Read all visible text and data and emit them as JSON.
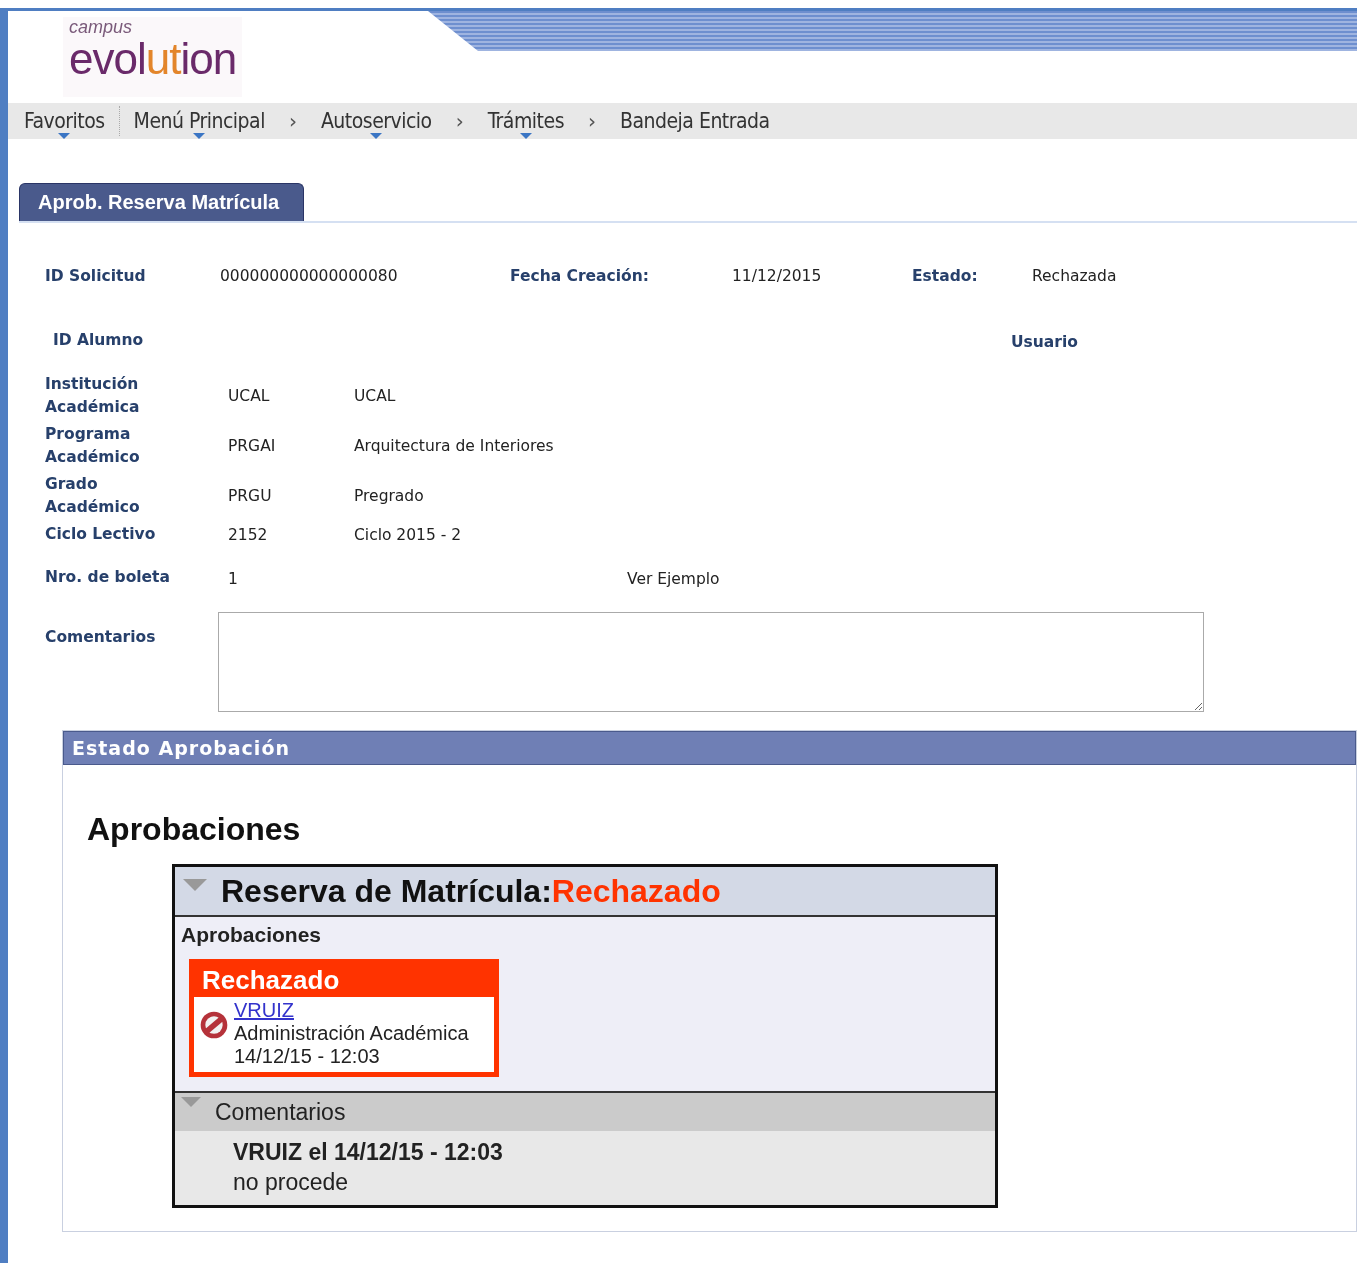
{
  "logo": {
    "top": "campus",
    "parts": [
      {
        "text": "evol",
        "accent": false
      },
      {
        "text": "ut",
        "accent": true
      },
      {
        "text": "ion",
        "accent": false
      }
    ]
  },
  "nav": [
    {
      "label": "Favoritos",
      "menu": true,
      "divider": true
    },
    {
      "label": "Menú Principal",
      "menu": true,
      "separator": "›"
    },
    {
      "label": "Autoservicio",
      "menu": true,
      "separator": "›"
    },
    {
      "label": "Trámites",
      "menu": true,
      "separator": "›"
    },
    {
      "label": "Bandeja Entrada",
      "menu": false
    }
  ],
  "tabs": [
    {
      "label": "Aprob. Reserva Matrícula",
      "selected": true
    }
  ],
  "header_fields": [
    {
      "label": "ID Solicitud",
      "value": "000000000000000080"
    },
    {
      "label": "Fecha Creación:",
      "value": "11/12/2015"
    },
    {
      "label": "Estado:",
      "value": "Rechazada"
    }
  ],
  "id_alumno": {
    "label": "ID Alumno"
  },
  "usuario": {
    "label": "Usuario"
  },
  "details": [
    {
      "label": "Institución Académica",
      "code": "UCAL",
      "description": "UCAL"
    },
    {
      "label": "Programa Académico",
      "code": "PRGAI",
      "description": "Arquitectura de Interiores"
    },
    {
      "label": "Grado Académico",
      "code": "PRGU",
      "description": "Pregrado"
    },
    {
      "label": "Ciclo Lectivo",
      "code": "2152",
      "description": "Ciclo 2015 - 2"
    }
  ],
  "boleta": {
    "label": "Nro. de boleta",
    "value": "1",
    "link": "Ver Ejemplo"
  },
  "comments_field": {
    "label": "Comentarios"
  },
  "approval_section": {
    "title": "Estado Aprobación",
    "heading": "Aprobaciones",
    "workflow": {
      "title": "Reserva de Matrícula:",
      "status": "Rechazado",
      "color": "#ff3300",
      "expanded": true,
      "subheading": "Aprobaciones",
      "step": {
        "status": "Rechazado",
        "color": "#ff3300",
        "user": "VRUIZ",
        "role": "Administración Académica",
        "datetime": "14/12/15 - 12:03"
      },
      "comments": {
        "title": "Comentarios",
        "expanded": true,
        "author_line": "VRUIZ el 14/12/15 - 12:03",
        "text": "no procede"
      }
    }
  }
}
